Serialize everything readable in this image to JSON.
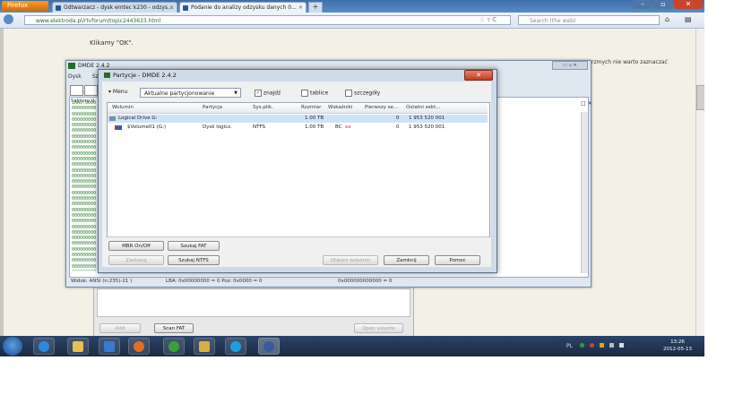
{
  "browser": {
    "menu_label": "Firefox",
    "tabs": [
      {
        "label": "Odtwarzacz - dysk emtec k230 - odzys..."
      },
      {
        "label": "Podanie do analizy odzysku danych 0..."
      }
    ],
    "new_tab": "+",
    "url": "www.elektroda.pl/rtvforum/topic2443633.html",
    "search_placeholder": "Search (the web)"
  },
  "page": {
    "text_ok": "Klikamy \"OK\".",
    "bg_text_right": "rzmych nie warto zaznaczać"
  },
  "dmde": {
    "title": "DMDE 2.4.2",
    "menu": [
      "Dysk",
      "Sz"
    ],
    "side_label": "Sektory 0",
    "status_left": "Widok: ANSI (n:235)-21 )",
    "status_mid": "LBA: 0x00000000 = 0    Poz: 0x0000 = 0",
    "status_right": "0x000000000000 = 0",
    "hex_fill": "1AA0:0000000000000000000000000000000000000000000000000000000000000000000000000000000000000000000000000000000000000000000000000000000000000000000000000000000000000000000000000000000000000000000000000000000000000000000000000000000000000000000000000000000000000000000000000000000000000000000000000000000000000000000000000000000"
  },
  "dialog": {
    "title": "Partycje - DMDE 2.4.2",
    "close": "✕",
    "menu_button": "▾ Menu",
    "combo_value": "Aktualne partycjonowanie",
    "check_znajdz": "znajdź",
    "check_tablice": "tablice",
    "check_szczegoly": "szczegóły",
    "columns": [
      "Wolumin",
      "Partycja",
      "Sys.plik.",
      "Rozmiar",
      "Wskaźniki",
      "Pierwszy se...",
      "Ostatni sekt..."
    ],
    "rows": [
      {
        "wolumin": "Logical Drive G:",
        "partycja": "",
        "sysplik": "",
        "rozmiar": "1.00 TB",
        "wskazniki": "",
        "pierwszy": "0",
        "ostatni": "1 953 520 001"
      },
      {
        "wolumin": "$Volume01 (G:)",
        "partycja": "Dysk logicz.",
        "sysplik": "NTFS",
        "rozmiar": "1.00 TB",
        "wskazniki": "BC",
        "wskazniki_red": "xx",
        "pierwszy": "0",
        "ostatni": "1 953 520 001"
      }
    ],
    "buttons": {
      "mbr": "MBR On/Off",
      "fat": "Szukaj FAT",
      "zastosuj": "Zastosuj",
      "ntfs": "Szukaj NTFS",
      "otworz": "Otwórz wolumin",
      "zamknij": "Zamknij",
      "pomoc": "Pomoc"
    }
  },
  "lower": {
    "btn_add": "Add",
    "btn_scan": "Scan FAT",
    "btn_open": "Open volume"
  },
  "taskbar": {
    "tray_lang": "PL",
    "time": "13:26",
    "date": "2012-05-13"
  },
  "colors": {
    "accent": "#5b8bc4",
    "close_red": "#c33c24",
    "hex_green": "#2a7a2a"
  }
}
